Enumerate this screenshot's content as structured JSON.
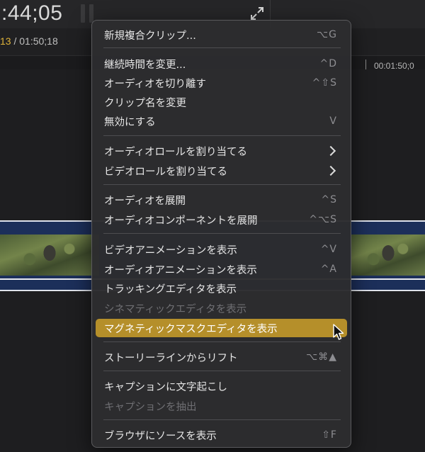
{
  "viewer": {
    "timecode": ":44;05",
    "current_time": "13",
    "total_time": " / 01:50;18",
    "ruler_time": "00:01:50;0"
  },
  "menu": {
    "items": [
      {
        "label": "新規複合クリップ...",
        "shortcut": "⌥G",
        "disabled": false
      },
      {
        "label": "継続時間を変更...",
        "shortcut": "^D",
        "disabled": false
      },
      {
        "label": "オーディオを切り離す",
        "shortcut": "^⇧S",
        "disabled": false
      },
      {
        "label": "クリップ名を変更",
        "shortcut": "",
        "disabled": false
      },
      {
        "label": "無効にする",
        "shortcut": "V",
        "disabled": false
      },
      {
        "label": "オーディオロールを割り当てる",
        "shortcut": "",
        "submenu": true,
        "disabled": false
      },
      {
        "label": "ビデオロールを割り当てる",
        "shortcut": "",
        "submenu": true,
        "disabled": false
      },
      {
        "label": "オーディオを展開",
        "shortcut": "^S",
        "disabled": false
      },
      {
        "label": "オーディオコンポーネントを展開",
        "shortcut": "^⌥S",
        "disabled": false
      },
      {
        "label": "ビデオアニメーションを表示",
        "shortcut": "^V",
        "disabled": false
      },
      {
        "label": "オーディオアニメーションを表示",
        "shortcut": "^A",
        "disabled": false
      },
      {
        "label": "トラッキングエディタを表示",
        "shortcut": "",
        "disabled": false
      },
      {
        "label": "シネマティックエディタを表示",
        "shortcut": "",
        "disabled": true
      },
      {
        "label": "マグネティックマスクエディタを表示",
        "shortcut": "",
        "disabled": false,
        "highlighted": true
      },
      {
        "label": "ストーリーラインからリフト",
        "shortcut": "⌥⌘▲",
        "disabled": false
      },
      {
        "label": "キャプションに文字起こし",
        "shortcut": "",
        "disabled": false
      },
      {
        "label": "キャプションを抽出",
        "shortcut": "",
        "disabled": true
      },
      {
        "label": "ブラウザにソースを表示",
        "shortcut": "⇧F",
        "disabled": false
      }
    ]
  },
  "colors": {
    "highlight": "#b58f2a",
    "timecode_accent": "#e0b43a",
    "clip_blue": "#1c2f5a"
  }
}
